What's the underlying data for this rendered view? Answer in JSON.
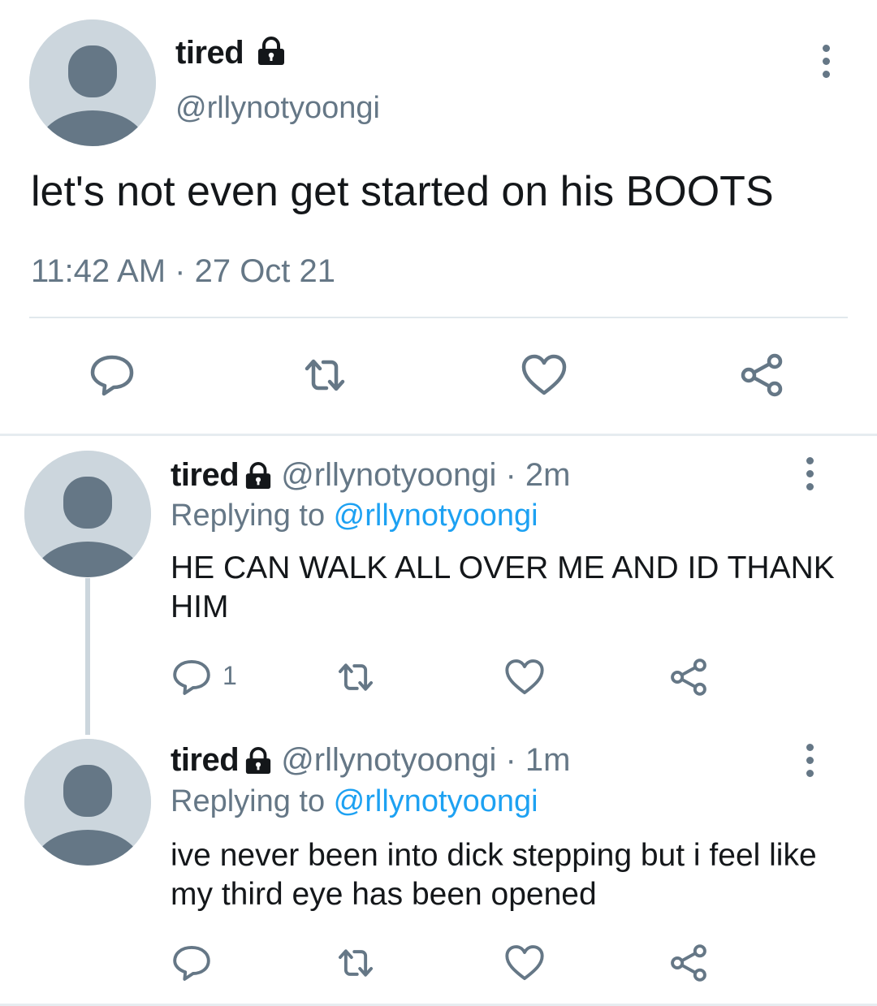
{
  "colors": {
    "text": "#14171a",
    "secondary": "#657786",
    "link": "#1da1f2",
    "avatar_bg": "#ccd6dd",
    "avatar_fg": "#657786",
    "divider": "#e1e8ed"
  },
  "icons": {
    "lock": "lock-icon",
    "more": "more-vertical-icon",
    "reply": "reply-bubble-icon",
    "retweet": "retweet-icon",
    "like": "heart-icon",
    "share": "share-icon",
    "avatar": "default-avatar-icon"
  },
  "main_tweet": {
    "name": "tired",
    "handle": "@rllynotyoongi",
    "text": "let's not even get started on his BOOTS",
    "timestamp": "11:42 AM · 27 Oct 21"
  },
  "replies": [
    {
      "name": "tired",
      "meta": "@rllynotyoongi · 2m",
      "replying_prefix": "Replying to ",
      "replying_to": "@rllynotyoongi",
      "text": "HE CAN WALK ALL OVER ME AND ID THANK HIM",
      "reply_count": "1"
    },
    {
      "name": "tired",
      "meta": "@rllynotyoongi · 1m",
      "replying_prefix": "Replying to ",
      "replying_to": "@rllynotyoongi",
      "text": "ive never been into dick stepping but i feel like my third eye has been opened"
    }
  ]
}
